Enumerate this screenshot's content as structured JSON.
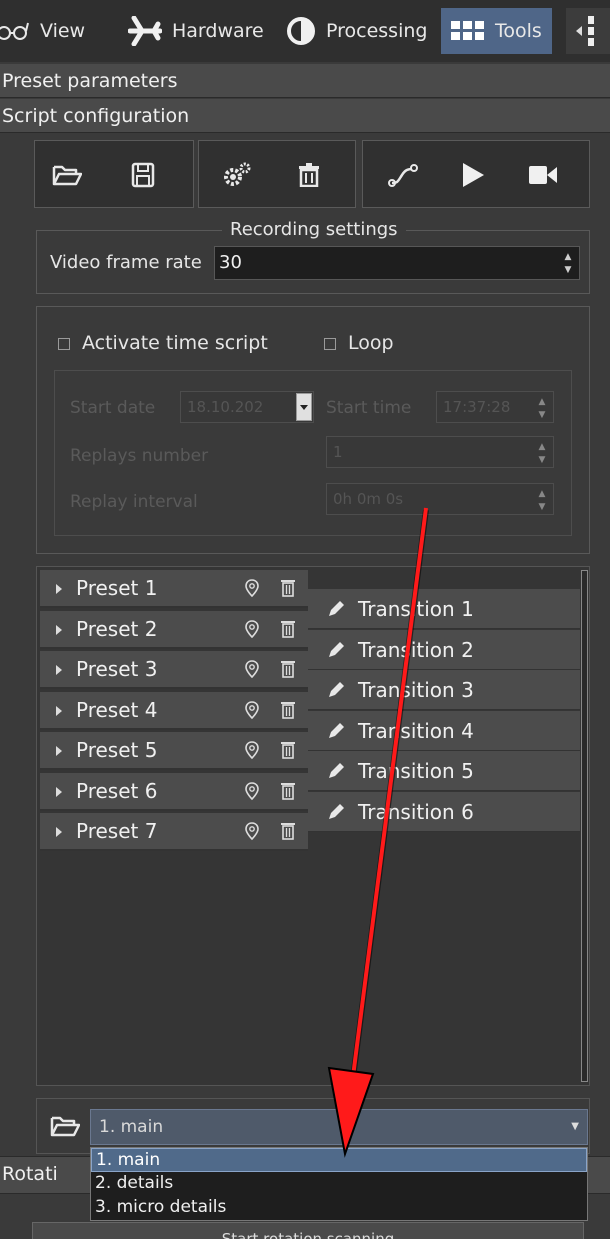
{
  "tabs": [
    {
      "label": "View",
      "icon": "glasses-icon",
      "active": false
    },
    {
      "label": "Hardware",
      "icon": "airplane-icon",
      "active": false
    },
    {
      "label": "Processing",
      "icon": "half-circle-icon",
      "active": false
    },
    {
      "label": "Tools",
      "icon": "grid-icon",
      "active": true
    }
  ],
  "sections": {
    "preset_parameters": "Preset parameters",
    "script_configuration": "Script configuration",
    "rotation": "Rotati"
  },
  "toolbar": {
    "icons": [
      "folder-open-icon",
      "save-icon",
      "gears-icon",
      "trash-icon",
      "path-icon",
      "play-icon",
      "camera-icon"
    ]
  },
  "recording": {
    "legend": "Recording settings",
    "frame_rate_label": "Video frame rate",
    "frame_rate_value": "30"
  },
  "time_script": {
    "activate_label": "Activate time script",
    "loop_label": "Loop",
    "start_date_label": "Start date",
    "start_date_value": "18.10.202",
    "start_time_label": "Start time",
    "start_time_value": "17:37:28",
    "replays_label": "Replays number",
    "replays_value": "1",
    "interval_label": "Replay interval",
    "interval_value": "0h 0m 0s"
  },
  "presets": [
    "Preset 1",
    "Preset 2",
    "Preset 3",
    "Preset 4",
    "Preset 5",
    "Preset 6",
    "Preset 7"
  ],
  "transitions": [
    "Transition 1",
    "Transition 2",
    "Transition 3",
    "Transition 4",
    "Transition 5",
    "Transition 6"
  ],
  "script_select": {
    "current": "1. main",
    "options": [
      "1. main",
      "2. details",
      "3. micro details"
    ]
  },
  "bottom_button": "Start rotation scanning",
  "colors": {
    "accent": "#4f6688",
    "arrow": "#ff1a1a"
  }
}
